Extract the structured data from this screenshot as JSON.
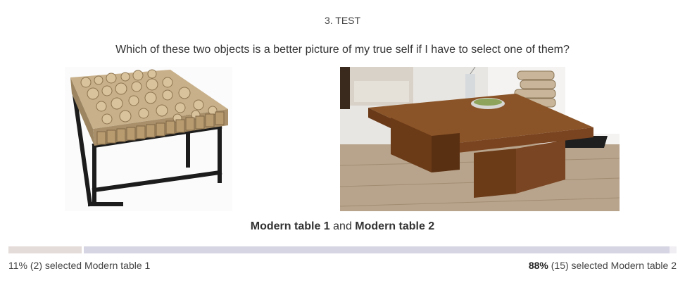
{
  "section": {
    "title": "3. TEST"
  },
  "question": {
    "text": "Which of these two objects is a better picture of my true self if I have to select one of them?"
  },
  "options": [
    {
      "label": "Modern table 1",
      "percent_label": "11%",
      "count_label": "(2)",
      "fraction": 0.11,
      "color": "#e3dcd9"
    },
    {
      "label": "Modern table 2",
      "percent_label": "88%",
      "count_label": "(15)",
      "fraction": 0.88,
      "color": "#d6d5e3"
    }
  ],
  "caption": {
    "connector": "and"
  },
  "result": {
    "selected_text": "selected"
  }
}
